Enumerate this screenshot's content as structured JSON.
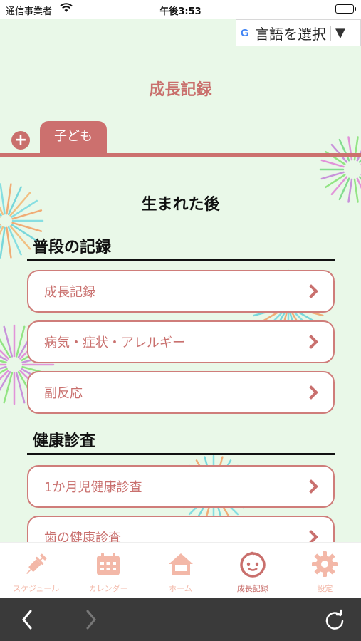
{
  "status_bar": {
    "carrier": "通信事業者",
    "time": "午後3:53"
  },
  "translate": {
    "label": "言語を選択",
    "arrow": "▼",
    "g_letter": "G"
  },
  "header": {
    "title": "成長記録"
  },
  "tabs": {
    "add_symbol": "+",
    "child_tab_label": "子ども"
  },
  "content": {
    "section_heading": "生まれた後",
    "groups": [
      {
        "title": "普段の記録",
        "items": [
          "成長記録",
          "病気・症状・アレルギー",
          "副反応"
        ]
      },
      {
        "title": "健康診査",
        "items": [
          "1か月児健康診査",
          "歯の健康診査"
        ]
      }
    ]
  },
  "tab_bar": {
    "items": [
      {
        "label": "スケジュール",
        "icon": "syringe-icon"
      },
      {
        "label": "カレンダー",
        "icon": "calendar-icon"
      },
      {
        "label": "ホーム",
        "icon": "home-icon"
      },
      {
        "label": "成長記録",
        "icon": "baby-face-icon",
        "active": true
      },
      {
        "label": "設定",
        "icon": "gear-icon"
      }
    ]
  },
  "colors": {
    "accent": "#cc706e",
    "background": "#e9f8e8",
    "tab_inactive": "#f3b8a8"
  }
}
